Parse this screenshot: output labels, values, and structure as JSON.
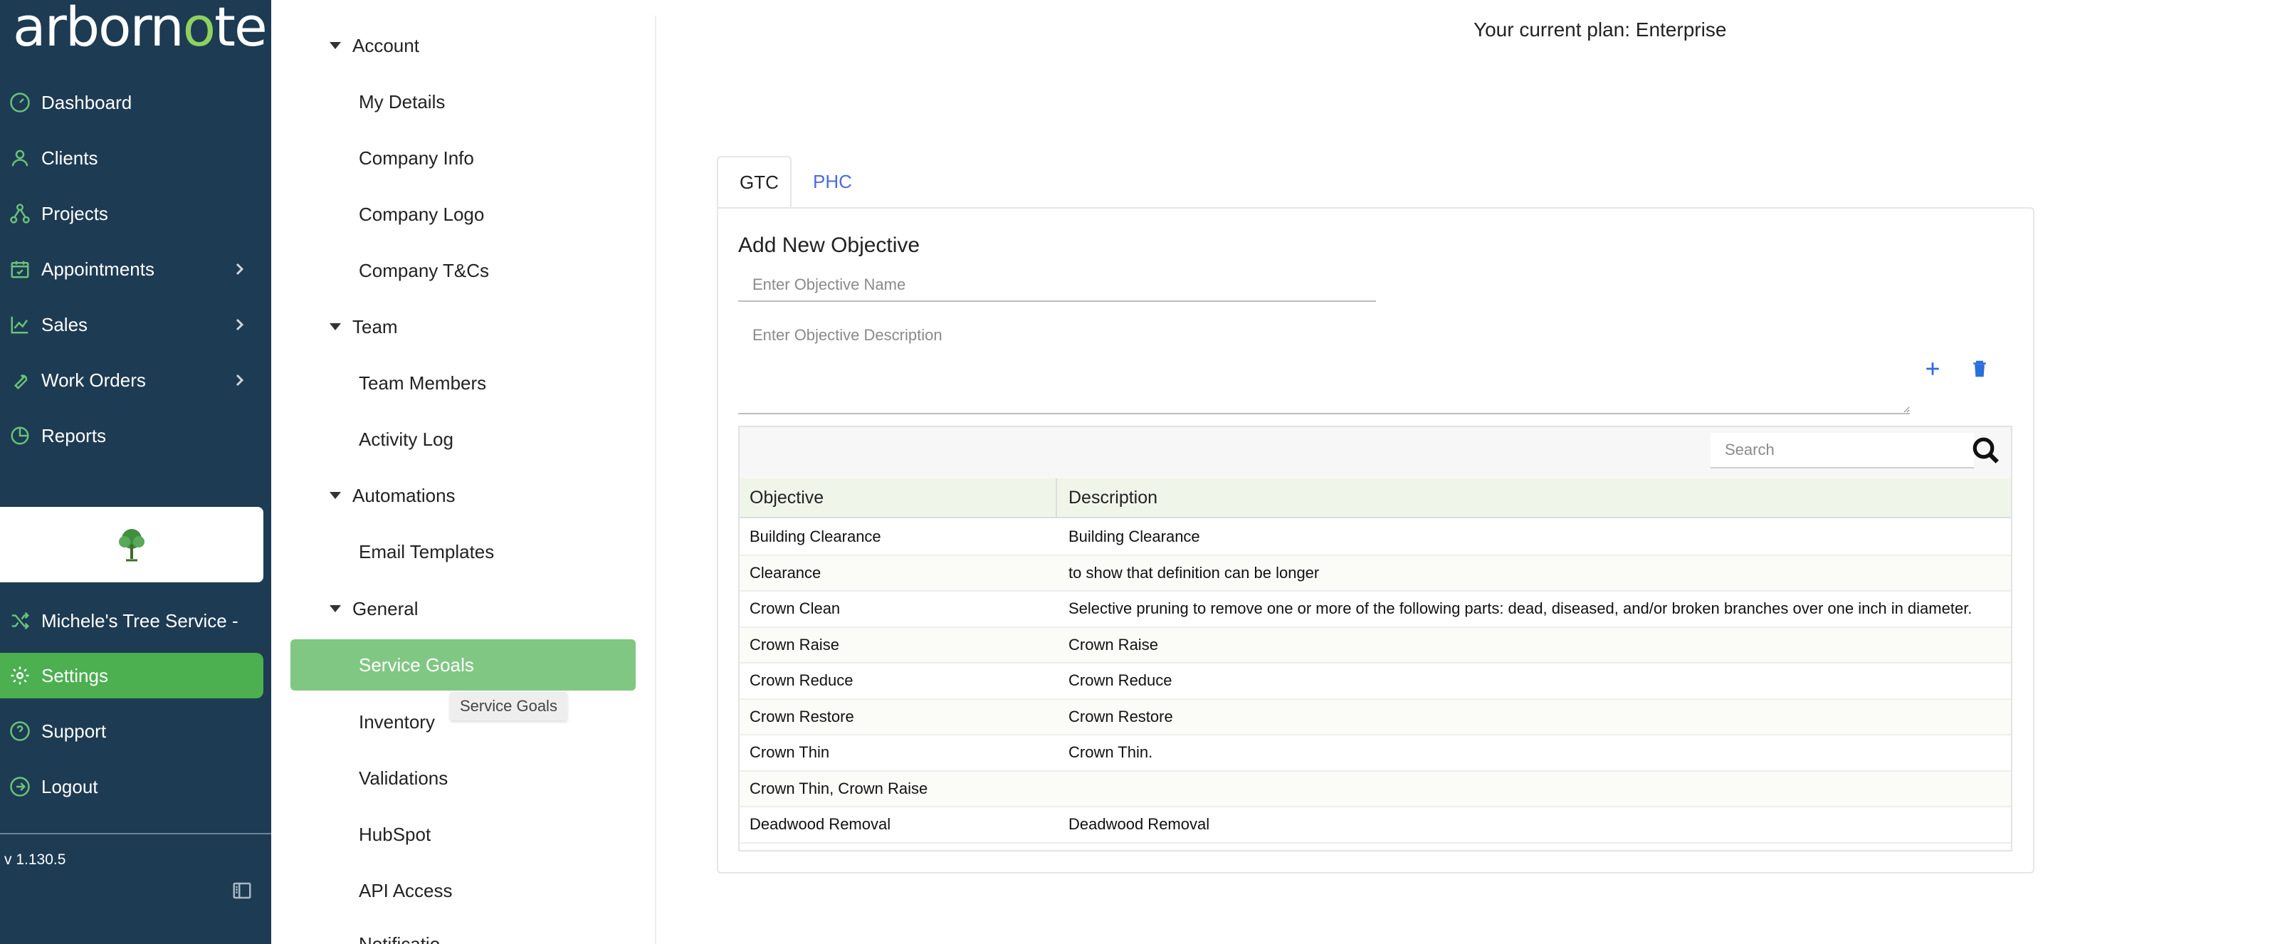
{
  "app": {
    "logo_text_1": "arborn",
    "logo_text_2": "o",
    "logo_text_3": "te"
  },
  "sidebar": {
    "items": [
      {
        "label": "Dashboard",
        "icon": "dashboard-gauge-icon"
      },
      {
        "label": "Clients",
        "icon": "user-icon"
      },
      {
        "label": "Projects",
        "icon": "projects-nodes-icon"
      },
      {
        "label": "Appointments",
        "icon": "calendar-check-icon",
        "expandable": true
      },
      {
        "label": "Sales",
        "icon": "chart-line-icon",
        "expandable": true
      },
      {
        "label": "Work Orders",
        "icon": "wrench-icon",
        "expandable": true
      },
      {
        "label": "Reports",
        "icon": "pie-chart-icon"
      }
    ],
    "company_switch": {
      "label": "Michele's Tree Service -",
      "icon": "shuffle-icon"
    },
    "bottom_items": [
      {
        "label": "Settings",
        "icon": "gear-icon",
        "active": true
      },
      {
        "label": "Support",
        "icon": "help-circle-icon"
      },
      {
        "label": "Logout",
        "icon": "logout-icon"
      }
    ],
    "version": "v 1.130.5"
  },
  "subnav": {
    "groups": {
      "account": "Account",
      "team": "Team",
      "automations": "Automations",
      "general": "General"
    },
    "items": {
      "my_details": "My Details",
      "company_info": "Company Info",
      "company_logo": "Company Logo",
      "company_tcs": "Company T&Cs",
      "team_members": "Team Members",
      "activity_log": "Activity Log",
      "email_templates": "Email Templates",
      "service_goals": "Service Goals",
      "inventory": "Inventory",
      "validations": "Validations",
      "hubspot": "HubSpot",
      "api_access": "API Access",
      "notifications": "Notificatio"
    },
    "tooltip": "Service Goals"
  },
  "main": {
    "plan": "Your current plan: Enterprise",
    "tabs": [
      {
        "label": "GTC",
        "active": true
      },
      {
        "label": "PHC",
        "active": false
      }
    ],
    "form": {
      "title": "Add New Objective",
      "name_placeholder": "Enter Objective Name",
      "name_value": "",
      "desc_placeholder": "Enter Objective Description",
      "desc_value": ""
    },
    "colors": {
      "accent_green": "#4caf50",
      "link_blue": "#4d6bdc",
      "icon_blue": "#2a6fdb"
    },
    "table": {
      "search_placeholder": "Search",
      "columns": [
        "Objective",
        "Description"
      ],
      "rows": [
        [
          "Building Clearance",
          "Building Clearance"
        ],
        [
          "Clearance",
          "to show that definition can be longer"
        ],
        [
          "Crown Clean",
          "Selective pruning to remove one or more of the following parts: dead, diseased, and/or broken branches over one inch in diameter."
        ],
        [
          "Crown Raise",
          "Crown Raise"
        ],
        [
          "Crown Reduce",
          "Crown Reduce"
        ],
        [
          "Crown Restore",
          "Crown Restore"
        ],
        [
          "Crown Thin",
          "Crown Thin."
        ],
        [
          "Crown Thin, Crown Raise",
          ""
        ],
        [
          "Deadwood Removal",
          "Deadwood Removal"
        ]
      ]
    }
  }
}
